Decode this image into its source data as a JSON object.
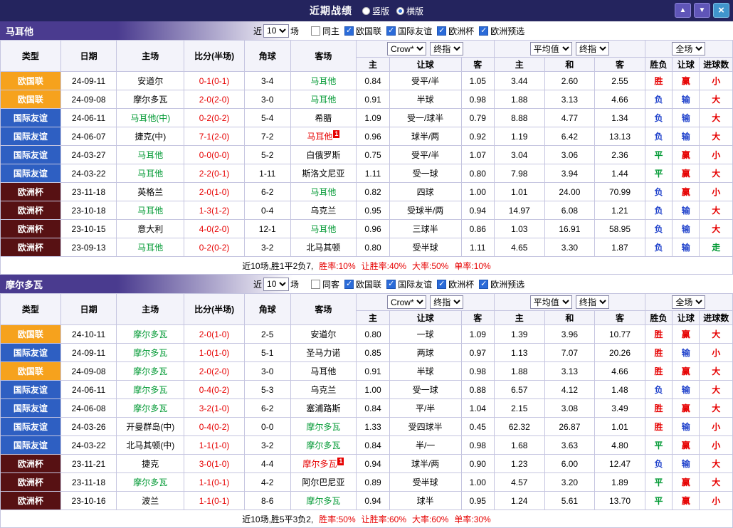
{
  "titlebar": {
    "title": "近期战绩",
    "radios": [
      {
        "label": "竖版",
        "checked": false
      },
      {
        "label": "横版",
        "checked": true
      }
    ],
    "buttons": {
      "up": "▲",
      "down": "▼",
      "close": "×"
    }
  },
  "table_header": {
    "static_cols": [
      "类型",
      "日期",
      "主场",
      "比分(半场)",
      "角球",
      "客场"
    ],
    "odds_group": {
      "select1": "Crow*",
      "select2": "终指",
      "cols": [
        "主",
        "让球",
        "客"
      ]
    },
    "avg_group": {
      "select1": "平均值",
      "select2": "终指",
      "cols": [
        "主",
        "和",
        "客"
      ]
    },
    "result_group": {
      "select": "全场",
      "cols": [
        "胜负",
        "让球",
        "进球数"
      ]
    }
  },
  "colors": {
    "accent_purple": "#4a3b8f",
    "titlebar_navy": "#24245e",
    "nations_league_orange": "#f6a21d",
    "friendly_blue": "#2e5fc2",
    "euro_maroon": "#571113",
    "win_red": "#e60000",
    "lose_blue": "#2244cc",
    "draw_green": "#009933"
  },
  "sections": [
    {
      "team": "马耳他",
      "filter": {
        "near": "近",
        "count": "10",
        "games": "场",
        "same": "同主",
        "same_checked": false,
        "leagues": [
          {
            "label": "欧国联",
            "checked": true
          },
          {
            "label": "国际友谊",
            "checked": true
          },
          {
            "label": "欧洲杯",
            "checked": true
          },
          {
            "label": "欧洲预选",
            "checked": true
          }
        ]
      },
      "rows": [
        {
          "type": "欧国联",
          "ts": "nl",
          "date": "24-09-11",
          "home": "安道尔",
          "hs": "",
          "score": "0-1(0-1)",
          "corner": "3-4",
          "away": "马耳他",
          "as": "green",
          "odds": [
            "0.84",
            "受平/半",
            "1.05"
          ],
          "avg": [
            "3.44",
            "2.60",
            "2.55"
          ],
          "res": [
            [
              "胜",
              "red"
            ],
            [
              "赢",
              "red"
            ],
            [
              "小",
              "red"
            ]
          ]
        },
        {
          "type": "欧国联",
          "ts": "nl",
          "date": "24-09-08",
          "home": "摩尔多瓦",
          "hs": "",
          "score": "2-0(2-0)",
          "corner": "3-0",
          "away": "马耳他",
          "as": "green",
          "odds": [
            "0.91",
            "半球",
            "0.98"
          ],
          "avg": [
            "1.88",
            "3.13",
            "4.66"
          ],
          "res": [
            [
              "负",
              "blue"
            ],
            [
              "输",
              "blue"
            ],
            [
              "大",
              "red"
            ]
          ]
        },
        {
          "type": "国际友谊",
          "ts": "fr",
          "date": "24-06-11",
          "home": "马耳他(中)",
          "hs": "green",
          "score": "0-2(0-2)",
          "corner": "5-4",
          "away": "希腊",
          "as": "",
          "odds": [
            "1.09",
            "受一/球半",
            "0.79"
          ],
          "avg": [
            "8.88",
            "4.77",
            "1.34"
          ],
          "res": [
            [
              "负",
              "blue"
            ],
            [
              "输",
              "blue"
            ],
            [
              "大",
              "red"
            ]
          ]
        },
        {
          "type": "国际友谊",
          "ts": "fr",
          "date": "24-06-07",
          "home": "捷克(中)",
          "hs": "",
          "score": "7-1(2-0)",
          "corner": "7-2",
          "away": "马耳他",
          "as": "red",
          "abadge": "1",
          "odds": [
            "0.96",
            "球半/两",
            "0.92"
          ],
          "avg": [
            "1.19",
            "6.42",
            "13.13"
          ],
          "res": [
            [
              "负",
              "blue"
            ],
            [
              "输",
              "blue"
            ],
            [
              "大",
              "red"
            ]
          ]
        },
        {
          "type": "国际友谊",
          "ts": "fr",
          "date": "24-03-27",
          "home": "马耳他",
          "hs": "green",
          "score": "0-0(0-0)",
          "corner": "5-2",
          "away": "白俄罗斯",
          "as": "",
          "odds": [
            "0.75",
            "受平/半",
            "1.07"
          ],
          "avg": [
            "3.04",
            "3.06",
            "2.36"
          ],
          "res": [
            [
              "平",
              "green"
            ],
            [
              "赢",
              "red"
            ],
            [
              "小",
              "red"
            ]
          ]
        },
        {
          "type": "国际友谊",
          "ts": "fr",
          "date": "24-03-22",
          "home": "马耳他",
          "hs": "green",
          "score": "2-2(0-1)",
          "corner": "1-11",
          "away": "斯洛文尼亚",
          "as": "",
          "odds": [
            "1.11",
            "受一球",
            "0.80"
          ],
          "avg": [
            "7.98",
            "3.94",
            "1.44"
          ],
          "res": [
            [
              "平",
              "green"
            ],
            [
              "赢",
              "red"
            ],
            [
              "大",
              "red"
            ]
          ]
        },
        {
          "type": "欧洲杯",
          "ts": "ec",
          "date": "23-11-18",
          "home": "英格兰",
          "hs": "",
          "score": "2-0(1-0)",
          "corner": "6-2",
          "away": "马耳他",
          "as": "green",
          "odds": [
            "0.82",
            "四球",
            "1.00"
          ],
          "avg": [
            "1.01",
            "24.00",
            "70.99"
          ],
          "res": [
            [
              "负",
              "blue"
            ],
            [
              "赢",
              "red"
            ],
            [
              "小",
              "red"
            ]
          ]
        },
        {
          "type": "欧洲杯",
          "ts": "ec",
          "date": "23-10-18",
          "home": "马耳他",
          "hs": "green",
          "score": "1-3(1-2)",
          "corner": "0-4",
          "away": "乌克兰",
          "as": "",
          "odds": [
            "0.95",
            "受球半/两",
            "0.94"
          ],
          "avg": [
            "14.97",
            "6.08",
            "1.21"
          ],
          "res": [
            [
              "负",
              "blue"
            ],
            [
              "输",
              "blue"
            ],
            [
              "大",
              "red"
            ]
          ]
        },
        {
          "type": "欧洲杯",
          "ts": "ec",
          "date": "23-10-15",
          "home": "意大利",
          "hs": "",
          "score": "4-0(2-0)",
          "corner": "12-1",
          "away": "马耳他",
          "as": "green",
          "odds": [
            "0.96",
            "三球半",
            "0.86"
          ],
          "avg": [
            "1.03",
            "16.91",
            "58.95"
          ],
          "res": [
            [
              "负",
              "blue"
            ],
            [
              "输",
              "blue"
            ],
            [
              "大",
              "red"
            ]
          ]
        },
        {
          "type": "欧洲杯",
          "ts": "ec",
          "date": "23-09-13",
          "home": "马耳他",
          "hs": "green",
          "score": "0-2(0-2)",
          "corner": "3-2",
          "away": "北马其顿",
          "as": "",
          "odds": [
            "0.80",
            "受半球",
            "1.11"
          ],
          "avg": [
            "4.65",
            "3.30",
            "1.87"
          ],
          "res": [
            [
              "负",
              "blue"
            ],
            [
              "输",
              "blue"
            ],
            [
              "走",
              "green"
            ]
          ]
        }
      ],
      "footer": {
        "summary": "近10场,胜1平2负7,",
        "stats": [
          "胜率:10%",
          "让胜率:40%",
          "大率:50%",
          "单率:10%"
        ]
      }
    },
    {
      "team": "摩尔多瓦",
      "filter": {
        "near": "近",
        "count": "10",
        "games": "场",
        "same": "同客",
        "same_checked": false,
        "leagues": [
          {
            "label": "欧国联",
            "checked": true
          },
          {
            "label": "国际友谊",
            "checked": true
          },
          {
            "label": "欧洲杯",
            "checked": true
          },
          {
            "label": "欧洲预选",
            "checked": true
          }
        ]
      },
      "rows": [
        {
          "type": "欧国联",
          "ts": "nl",
          "date": "24-10-11",
          "home": "摩尔多瓦",
          "hs": "green",
          "score": "2-0(1-0)",
          "corner": "2-5",
          "away": "安道尔",
          "as": "",
          "odds": [
            "0.80",
            "一球",
            "1.09"
          ],
          "avg": [
            "1.39",
            "3.96",
            "10.77"
          ],
          "res": [
            [
              "胜",
              "red"
            ],
            [
              "赢",
              "red"
            ],
            [
              "大",
              "red"
            ]
          ]
        },
        {
          "type": "国际友谊",
          "ts": "fr",
          "date": "24-09-11",
          "home": "摩尔多瓦",
          "hs": "green",
          "score": "1-0(1-0)",
          "corner": "5-1",
          "away": "圣马力诺",
          "as": "",
          "odds": [
            "0.85",
            "两球",
            "0.97"
          ],
          "avg": [
            "1.13",
            "7.07",
            "20.26"
          ],
          "res": [
            [
              "胜",
              "red"
            ],
            [
              "输",
              "blue"
            ],
            [
              "小",
              "red"
            ]
          ]
        },
        {
          "type": "欧国联",
          "ts": "nl",
          "date": "24-09-08",
          "home": "摩尔多瓦",
          "hs": "green",
          "score": "2-0(2-0)",
          "corner": "3-0",
          "away": "马耳他",
          "as": "",
          "odds": [
            "0.91",
            "半球",
            "0.98"
          ],
          "avg": [
            "1.88",
            "3.13",
            "4.66"
          ],
          "res": [
            [
              "胜",
              "red"
            ],
            [
              "赢",
              "red"
            ],
            [
              "大",
              "red"
            ]
          ]
        },
        {
          "type": "国际友谊",
          "ts": "fr",
          "date": "24-06-11",
          "home": "摩尔多瓦",
          "hs": "green",
          "score": "0-4(0-2)",
          "corner": "5-3",
          "away": "乌克兰",
          "as": "",
          "odds": [
            "1.00",
            "受一球",
            "0.88"
          ],
          "avg": [
            "6.57",
            "4.12",
            "1.48"
          ],
          "res": [
            [
              "负",
              "blue"
            ],
            [
              "输",
              "blue"
            ],
            [
              "大",
              "red"
            ]
          ]
        },
        {
          "type": "国际友谊",
          "ts": "fr",
          "date": "24-06-08",
          "home": "摩尔多瓦",
          "hs": "green",
          "score": "3-2(1-0)",
          "corner": "6-2",
          "away": "塞浦路斯",
          "as": "",
          "odds": [
            "0.84",
            "平/半",
            "1.04"
          ],
          "avg": [
            "2.15",
            "3.08",
            "3.49"
          ],
          "res": [
            [
              "胜",
              "red"
            ],
            [
              "赢",
              "red"
            ],
            [
              "大",
              "red"
            ]
          ]
        },
        {
          "type": "国际友谊",
          "ts": "fr",
          "date": "24-03-26",
          "home": "开曼群岛(中)",
          "hs": "",
          "score": "0-4(0-2)",
          "corner": "0-0",
          "away": "摩尔多瓦",
          "as": "green",
          "odds": [
            "1.33",
            "受四球半",
            "0.45"
          ],
          "avg": [
            "62.32",
            "26.87",
            "1.01"
          ],
          "res": [
            [
              "胜",
              "red"
            ],
            [
              "输",
              "blue"
            ],
            [
              "小",
              "red"
            ]
          ]
        },
        {
          "type": "国际友谊",
          "ts": "fr",
          "date": "24-03-22",
          "home": "北马其顿(中)",
          "hs": "",
          "score": "1-1(1-0)",
          "corner": "3-2",
          "away": "摩尔多瓦",
          "as": "green",
          "odds": [
            "0.84",
            "半/一",
            "0.98"
          ],
          "avg": [
            "1.68",
            "3.63",
            "4.80"
          ],
          "res": [
            [
              "平",
              "green"
            ],
            [
              "赢",
              "red"
            ],
            [
              "小",
              "red"
            ]
          ]
        },
        {
          "type": "欧洲杯",
          "ts": "ec",
          "date": "23-11-21",
          "home": "捷克",
          "hs": "",
          "score": "3-0(1-0)",
          "corner": "4-4",
          "away": "摩尔多瓦",
          "as": "red",
          "abadge": "1",
          "odds": [
            "0.94",
            "球半/两",
            "0.90"
          ],
          "avg": [
            "1.23",
            "6.00",
            "12.47"
          ],
          "res": [
            [
              "负",
              "blue"
            ],
            [
              "输",
              "blue"
            ],
            [
              "大",
              "red"
            ]
          ]
        },
        {
          "type": "欧洲杯",
          "ts": "ec",
          "date": "23-11-18",
          "home": "摩尔多瓦",
          "hs": "green",
          "score": "1-1(0-1)",
          "corner": "4-2",
          "away": "阿尔巴尼亚",
          "as": "",
          "odds": [
            "0.89",
            "受半球",
            "1.00"
          ],
          "avg": [
            "4.57",
            "3.20",
            "1.89"
          ],
          "res": [
            [
              "平",
              "green"
            ],
            [
              "赢",
              "red"
            ],
            [
              "大",
              "red"
            ]
          ]
        },
        {
          "type": "欧洲杯",
          "ts": "ec",
          "date": "23-10-16",
          "home": "波兰",
          "hs": "",
          "score": "1-1(0-1)",
          "corner": "8-6",
          "away": "摩尔多瓦",
          "as": "green",
          "odds": [
            "0.94",
            "球半",
            "0.95"
          ],
          "avg": [
            "1.24",
            "5.61",
            "13.70"
          ],
          "res": [
            [
              "平",
              "green"
            ],
            [
              "赢",
              "red"
            ],
            [
              "小",
              "red"
            ]
          ]
        }
      ],
      "footer": {
        "summary": "近10场,胜5平3负2,",
        "stats": [
          "胜率:50%",
          "让胜率:60%",
          "大率:60%",
          "单率:30%"
        ]
      }
    }
  ]
}
